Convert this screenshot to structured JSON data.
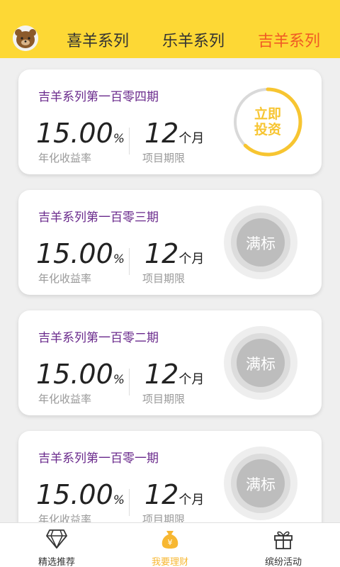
{
  "header": {
    "tabs": [
      {
        "label": "喜羊系列"
      },
      {
        "label": "乐羊系列"
      },
      {
        "label": "吉羊系列"
      }
    ],
    "active_tab": 2
  },
  "products": [
    {
      "title": "吉羊系列第一百零四期",
      "rate": "15.00",
      "rate_unit": "%",
      "rate_label": "年化收益率",
      "term": "12",
      "term_unit": "个月",
      "term_label": "项目期限",
      "status": "立即投资",
      "status_line1": "立即",
      "status_line2": "投资",
      "progress": 0.62
    },
    {
      "title": "吉羊系列第一百零三期",
      "rate": "15.00",
      "rate_unit": "%",
      "rate_label": "年化收益率",
      "term": "12",
      "term_unit": "个月",
      "term_label": "项目期限",
      "status": "满标"
    },
    {
      "title": "吉羊系列第一百零二期",
      "rate": "15.00",
      "rate_unit": "%",
      "rate_label": "年化收益率",
      "term": "12",
      "term_unit": "个月",
      "term_label": "项目期限",
      "status": "满标"
    },
    {
      "title": "吉羊系列第一百零一期",
      "rate": "15.00",
      "rate_unit": "%",
      "rate_label": "年化收益率",
      "term": "12",
      "term_unit": "个月",
      "term_label": "项目期限",
      "status": "满标"
    }
  ],
  "bottom_nav": {
    "items": [
      {
        "label": "精选推荐",
        "icon": "diamond-icon"
      },
      {
        "label": "我要理财",
        "icon": "money-bag-icon"
      },
      {
        "label": "缤纷活动",
        "icon": "gift-icon"
      }
    ],
    "active_index": 1
  },
  "colors": {
    "header": "#fdd835",
    "active_tab": "#f05a24",
    "title": "#6a2a8c",
    "accent": "#f7c531"
  }
}
